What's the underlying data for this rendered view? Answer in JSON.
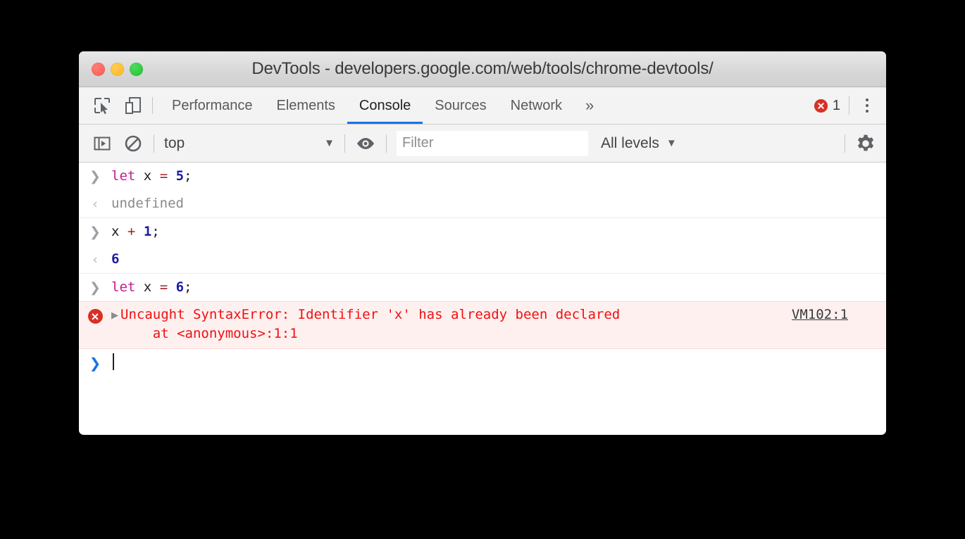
{
  "window": {
    "title": "DevTools - developers.google.com/web/tools/chrome-devtools/",
    "traffic_lights": {
      "close": "close-button",
      "minimize": "minimize-button",
      "maximize": "maximize-button"
    }
  },
  "tabbar": {
    "inspect_icon": "inspect-element-icon",
    "device_icon": "device-toolbar-icon",
    "tabs": [
      {
        "label": "Performance",
        "active": false
      },
      {
        "label": "Elements",
        "active": false
      },
      {
        "label": "Console",
        "active": true
      },
      {
        "label": "Sources",
        "active": false
      },
      {
        "label": "Network",
        "active": false
      }
    ],
    "more_tabs": "»",
    "error_count": "1",
    "accent_color": "#1a73e8",
    "error_color": "#d93025"
  },
  "console_toolbar": {
    "sidebar_toggle_icon": "console-sidebar-toggle-icon",
    "clear_icon": "clear-console-icon",
    "context": {
      "value": "top",
      "caret": "▼"
    },
    "eye_icon": "live-expression-eye-icon",
    "filter": {
      "value": "",
      "placeholder": "Filter"
    },
    "levels": {
      "label": "All levels",
      "caret": "▼"
    },
    "settings_icon": "settings-gear-icon"
  },
  "console": {
    "messages": [
      {
        "kind": "input",
        "gutter": "❯",
        "tokens": [
          {
            "text": "let",
            "cls": "tok-kw"
          },
          {
            "text": " ",
            "cls": "tok-pun"
          },
          {
            "text": "x",
            "cls": "tok-id"
          },
          {
            "text": " ",
            "cls": "tok-pun"
          },
          {
            "text": "=",
            "cls": "tok-op"
          },
          {
            "text": " ",
            "cls": "tok-pun"
          },
          {
            "text": "5",
            "cls": "tok-num"
          },
          {
            "text": ";",
            "cls": "tok-pun"
          }
        ],
        "plain": "let x = 5;"
      },
      {
        "kind": "output",
        "gutter": "‹",
        "tokens": [
          {
            "text": "undefined",
            "cls": "tok-undef"
          }
        ],
        "plain": "undefined"
      },
      {
        "kind": "input",
        "gutter": "❯",
        "tokens": [
          {
            "text": "x",
            "cls": "tok-id"
          },
          {
            "text": " ",
            "cls": "tok-pun"
          },
          {
            "text": "+",
            "cls": "tok-op"
          },
          {
            "text": " ",
            "cls": "tok-pun"
          },
          {
            "text": "1",
            "cls": "tok-num"
          },
          {
            "text": ";",
            "cls": "tok-pun"
          }
        ],
        "plain": "x + 1;"
      },
      {
        "kind": "output",
        "gutter": "‹",
        "tokens": [
          {
            "text": "6",
            "cls": "tok-num"
          }
        ],
        "plain": "6"
      },
      {
        "kind": "input",
        "gutter": "❯",
        "tokens": [
          {
            "text": "let",
            "cls": "tok-kw"
          },
          {
            "text": " ",
            "cls": "tok-pun"
          },
          {
            "text": "x",
            "cls": "tok-id"
          },
          {
            "text": " ",
            "cls": "tok-pun"
          },
          {
            "text": "=",
            "cls": "tok-op"
          },
          {
            "text": " ",
            "cls": "tok-pun"
          },
          {
            "text": "6",
            "cls": "tok-num"
          },
          {
            "text": ";",
            "cls": "tok-pun"
          }
        ],
        "plain": "let x = 6;"
      }
    ],
    "error": {
      "icon": "error-circle-icon",
      "disclosure": "▶",
      "line1": "Uncaught SyntaxError: Identifier 'x' has already been declared",
      "line2": "    at <anonymous>:1:1",
      "source_link": "VM102:1",
      "background": "#fff0f0",
      "text_color": "#f01010"
    },
    "prompt": {
      "gutter": "❯",
      "value": ""
    }
  }
}
